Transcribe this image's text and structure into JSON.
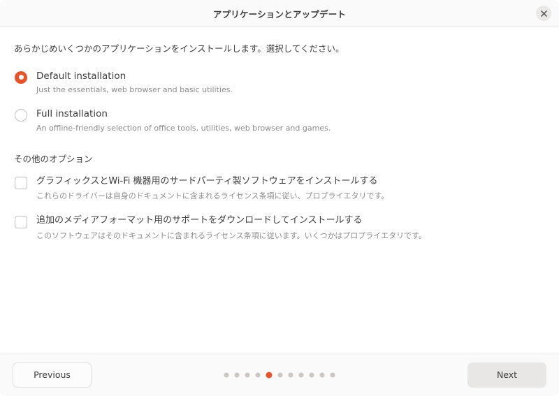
{
  "titlebar": {
    "title": "アプリケーションとアップデート",
    "close_label": "✕",
    "close_icon": "close-icon"
  },
  "content": {
    "intro": "あらかじめいくつかのアプリケーションをインストールします。選択してください。",
    "install_options": [
      {
        "label": "Default installation",
        "description": "Just the essentials, web browser and basic utilities.",
        "selected": true
      },
      {
        "label": "Full installation",
        "description": "An offline-friendly selection of office tools, utilities, web browser and games.",
        "selected": false
      }
    ],
    "other_options_heading": "その他のオプション",
    "checkbox_options": [
      {
        "label": "グラフィックスとWi-Fi 機器用のサードパーティ製ソフトウェアをインストールする",
        "description": "これらのドライバーは自身のドキュメントに含まれるライセンス条項に従い、プロプライエタリです。",
        "checked": false
      },
      {
        "label": "追加のメディアフォーマット用のサポートをダウンロードしてインストールする",
        "description": "このソフトウェアはそのドキュメントに含まれるライセンス条項に従います。いくつかはプロプライエタリです。",
        "checked": false
      }
    ]
  },
  "footer": {
    "previous_label": "Previous",
    "next_label": "Next",
    "pagination": {
      "total": 11,
      "current": 5
    }
  },
  "colors": {
    "accent": "#e8542a",
    "text": "#3d3d3d",
    "muted_text": "#8b8b8b",
    "header_bg": "#fafafa",
    "body_bg": "#ffffff",
    "border": "#e6e4e1"
  }
}
